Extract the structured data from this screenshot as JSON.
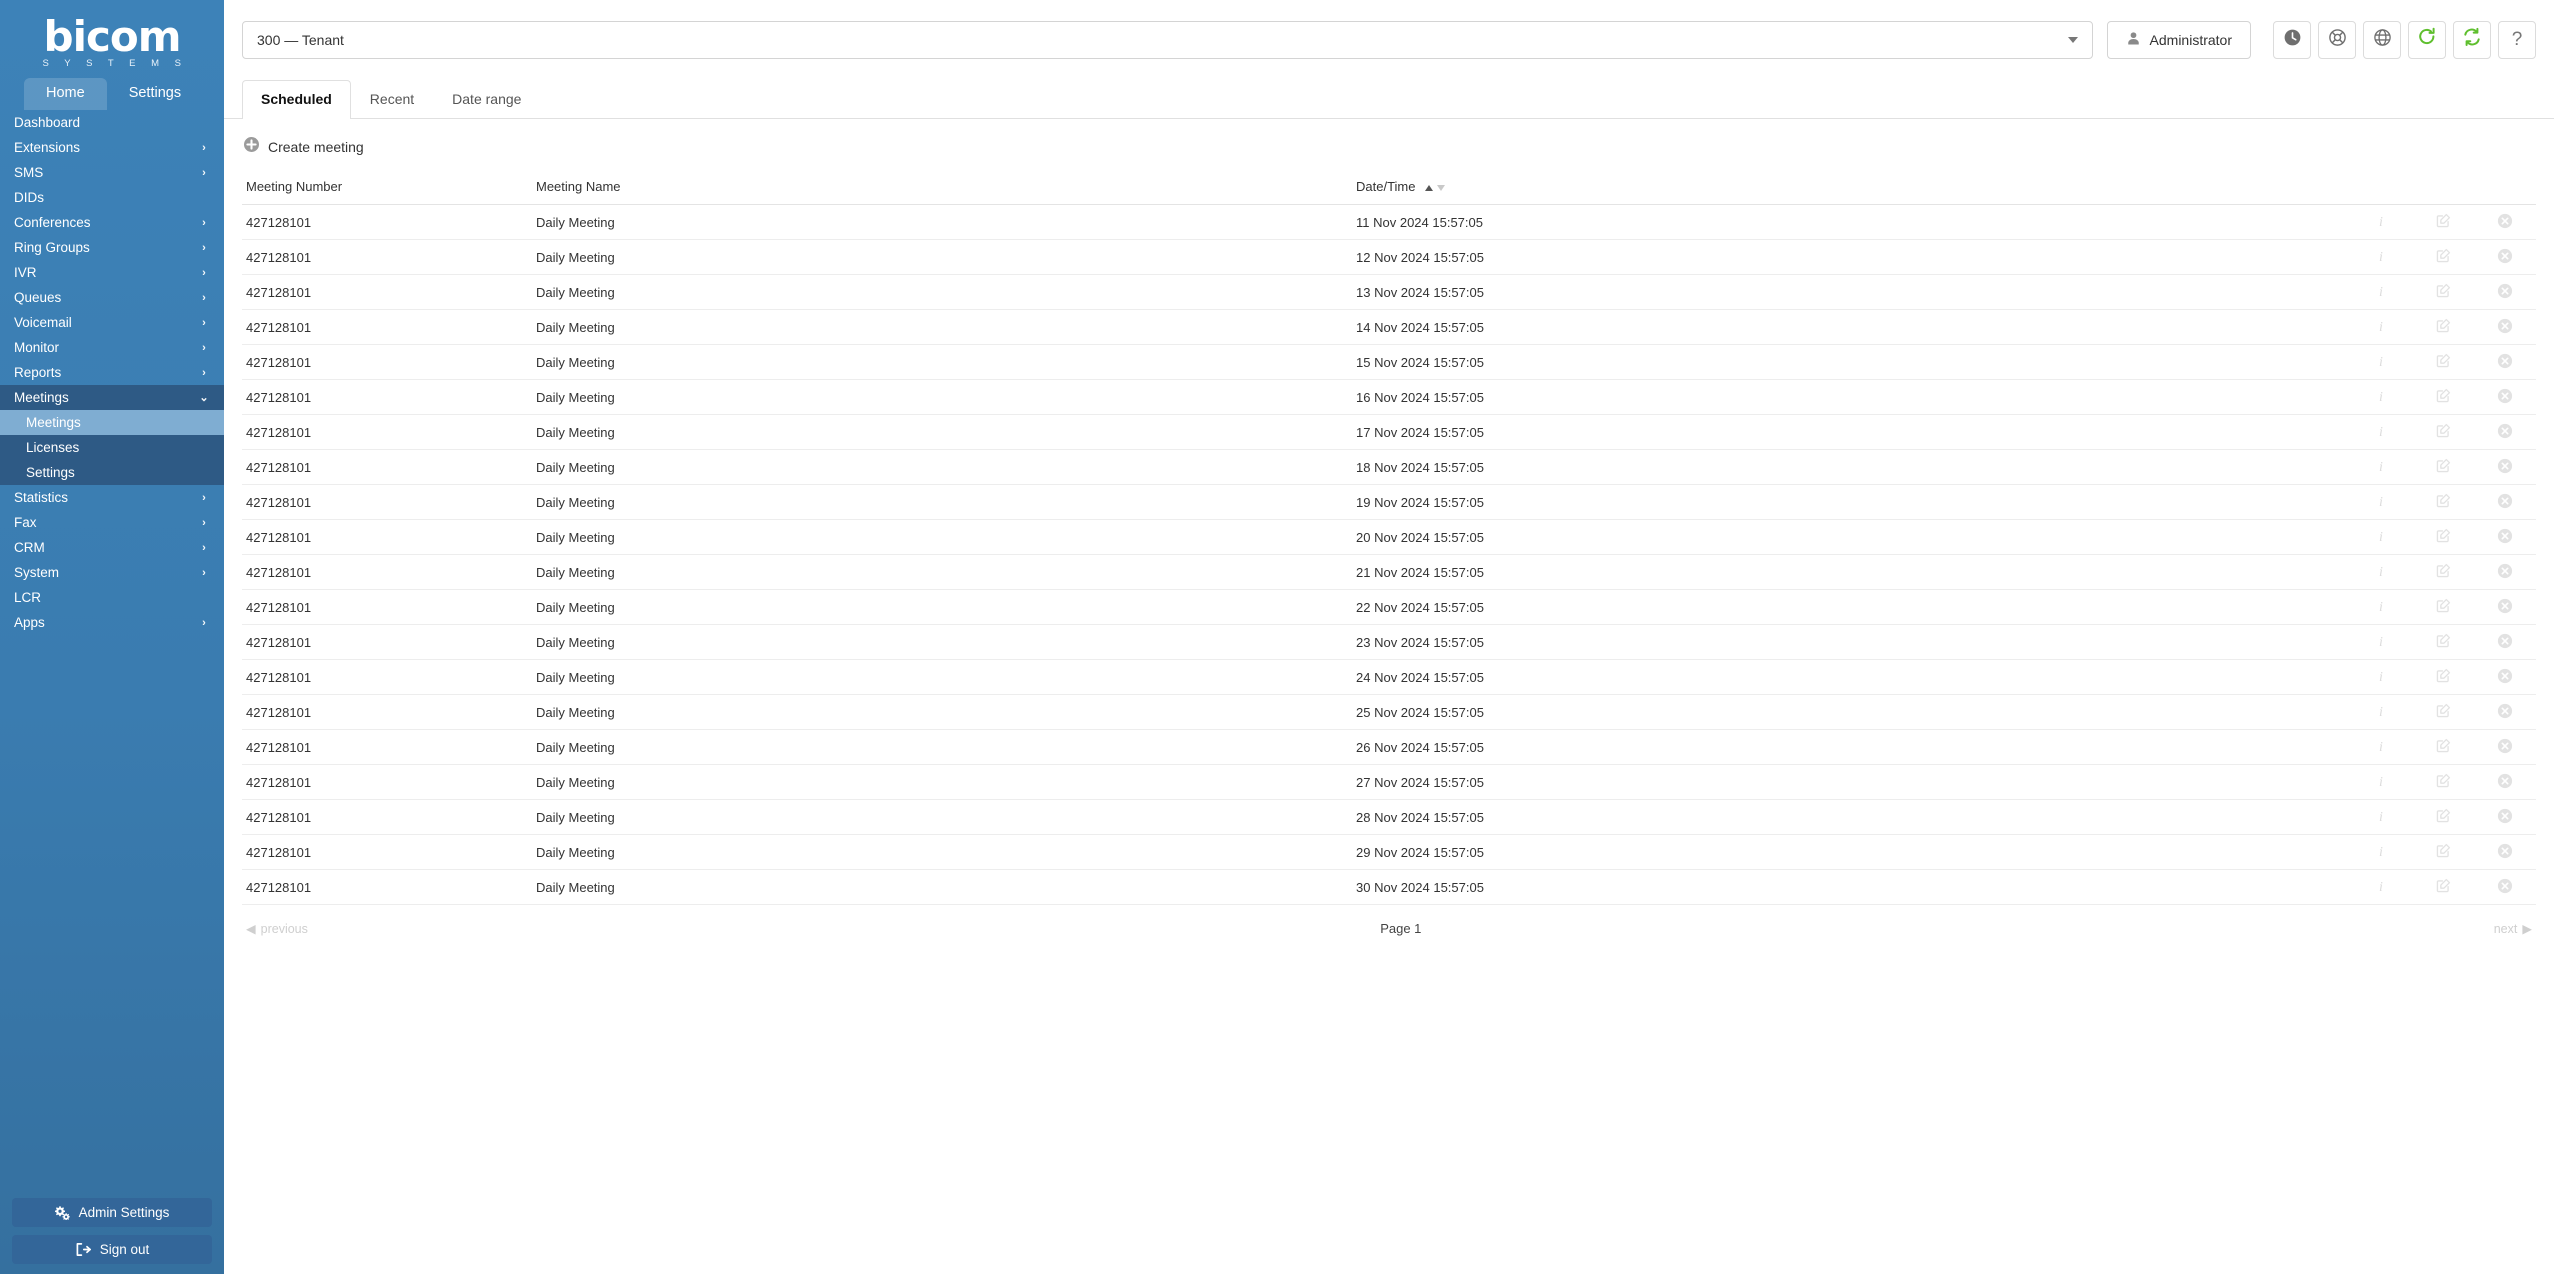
{
  "brand": {
    "name": "bicom",
    "tagline": "S Y S T E M S"
  },
  "sidebar": {
    "tabs": [
      {
        "label": "Home",
        "active": true
      },
      {
        "label": "Settings",
        "active": false
      }
    ],
    "items": [
      {
        "label": "Dashboard",
        "chevron": "",
        "expanded": false
      },
      {
        "label": "Extensions",
        "chevron": "›",
        "expanded": false
      },
      {
        "label": "SMS",
        "chevron": "›",
        "expanded": false
      },
      {
        "label": "DIDs",
        "chevron": "",
        "expanded": false
      },
      {
        "label": "Conferences",
        "chevron": "›",
        "expanded": false
      },
      {
        "label": "Ring Groups",
        "chevron": "›",
        "expanded": false
      },
      {
        "label": "IVR",
        "chevron": "›",
        "expanded": false
      },
      {
        "label": "Queues",
        "chevron": "›",
        "expanded": false
      },
      {
        "label": "Voicemail",
        "chevron": "›",
        "expanded": false
      },
      {
        "label": "Monitor",
        "chevron": "›",
        "expanded": false
      },
      {
        "label": "Reports",
        "chevron": "›",
        "expanded": false
      },
      {
        "label": "Meetings",
        "chevron": "⌄",
        "expanded": true
      },
      {
        "label": "Statistics",
        "chevron": "›",
        "expanded": false
      },
      {
        "label": "Fax",
        "chevron": "›",
        "expanded": false
      },
      {
        "label": "CRM",
        "chevron": "›",
        "expanded": false
      },
      {
        "label": "System",
        "chevron": "›",
        "expanded": false
      },
      {
        "label": "LCR",
        "chevron": "",
        "expanded": false
      },
      {
        "label": "Apps",
        "chevron": "›",
        "expanded": false
      }
    ],
    "submenu": [
      {
        "label": "Meetings",
        "active": true
      },
      {
        "label": "Licenses",
        "active": false
      },
      {
        "label": "Settings",
        "active": false
      }
    ],
    "buttons": [
      {
        "label": "Admin Settings",
        "icon": "gears-icon"
      },
      {
        "label": "Sign out",
        "icon": "sign-out-icon"
      }
    ]
  },
  "topbar": {
    "tenant_value": "300  —  Tenant",
    "user_label": "Administrator",
    "icons": [
      {
        "name": "clock-icon",
        "color": "#6f6f6f"
      },
      {
        "name": "lifebuoy-icon",
        "color": "#6f6f6f"
      },
      {
        "name": "globe-icon",
        "color": "#6f6f6f"
      },
      {
        "name": "reload-icon",
        "color": "#5fbf2e"
      },
      {
        "name": "sync-icon",
        "color": "#5fbf2e"
      },
      {
        "name": "help-icon",
        "color": "#777777",
        "glyph": "?"
      }
    ]
  },
  "tabs": [
    {
      "label": "Scheduled",
      "active": true
    },
    {
      "label": "Recent",
      "active": false
    },
    {
      "label": "Date range",
      "active": false
    }
  ],
  "toolbar": {
    "create_label": "Create meeting"
  },
  "table": {
    "columns": [
      "Meeting Number",
      "Meeting Name",
      "Date/Time",
      "",
      "",
      ""
    ],
    "sorted_column": "Date/Time",
    "sort_direction": "asc",
    "rows": [
      {
        "number": "427128101",
        "name": "Daily Meeting",
        "datetime": "11 Nov 2024 15:57:05"
      },
      {
        "number": "427128101",
        "name": "Daily Meeting",
        "datetime": "12 Nov 2024 15:57:05"
      },
      {
        "number": "427128101",
        "name": "Daily Meeting",
        "datetime": "13 Nov 2024 15:57:05"
      },
      {
        "number": "427128101",
        "name": "Daily Meeting",
        "datetime": "14 Nov 2024 15:57:05"
      },
      {
        "number": "427128101",
        "name": "Daily Meeting",
        "datetime": "15 Nov 2024 15:57:05"
      },
      {
        "number": "427128101",
        "name": "Daily Meeting",
        "datetime": "16 Nov 2024 15:57:05"
      },
      {
        "number": "427128101",
        "name": "Daily Meeting",
        "datetime": "17 Nov 2024 15:57:05"
      },
      {
        "number": "427128101",
        "name": "Daily Meeting",
        "datetime": "18 Nov 2024 15:57:05"
      },
      {
        "number": "427128101",
        "name": "Daily Meeting",
        "datetime": "19 Nov 2024 15:57:05"
      },
      {
        "number": "427128101",
        "name": "Daily Meeting",
        "datetime": "20 Nov 2024 15:57:05"
      },
      {
        "number": "427128101",
        "name": "Daily Meeting",
        "datetime": "21 Nov 2024 15:57:05"
      },
      {
        "number": "427128101",
        "name": "Daily Meeting",
        "datetime": "22 Nov 2024 15:57:05"
      },
      {
        "number": "427128101",
        "name": "Daily Meeting",
        "datetime": "23 Nov 2024 15:57:05"
      },
      {
        "number": "427128101",
        "name": "Daily Meeting",
        "datetime": "24 Nov 2024 15:57:05"
      },
      {
        "number": "427128101",
        "name": "Daily Meeting",
        "datetime": "25 Nov 2024 15:57:05"
      },
      {
        "number": "427128101",
        "name": "Daily Meeting",
        "datetime": "26 Nov 2024 15:57:05"
      },
      {
        "number": "427128101",
        "name": "Daily Meeting",
        "datetime": "27 Nov 2024 15:57:05"
      },
      {
        "number": "427128101",
        "name": "Daily Meeting",
        "datetime": "28 Nov 2024 15:57:05"
      },
      {
        "number": "427128101",
        "name": "Daily Meeting",
        "datetime": "29 Nov 2024 15:57:05"
      },
      {
        "number": "427128101",
        "name": "Daily Meeting",
        "datetime": "30 Nov 2024 15:57:05"
      }
    ],
    "row_actions": [
      {
        "name": "info-icon",
        "glyph": "i"
      },
      {
        "name": "edit-icon",
        "glyph": ""
      },
      {
        "name": "delete-icon",
        "glyph": ""
      }
    ]
  },
  "pagination": {
    "previous_label": "previous",
    "page_label": "Page 1",
    "next_label": "next"
  },
  "colors": {
    "sidebar_top": "#3d82b8",
    "sidebar_bottom": "#35709f",
    "submenu_bg": "#2e5a85",
    "submenu_active": "#7fadd2",
    "accent_green": "#5fbf2e",
    "button_blue": "#336699"
  }
}
